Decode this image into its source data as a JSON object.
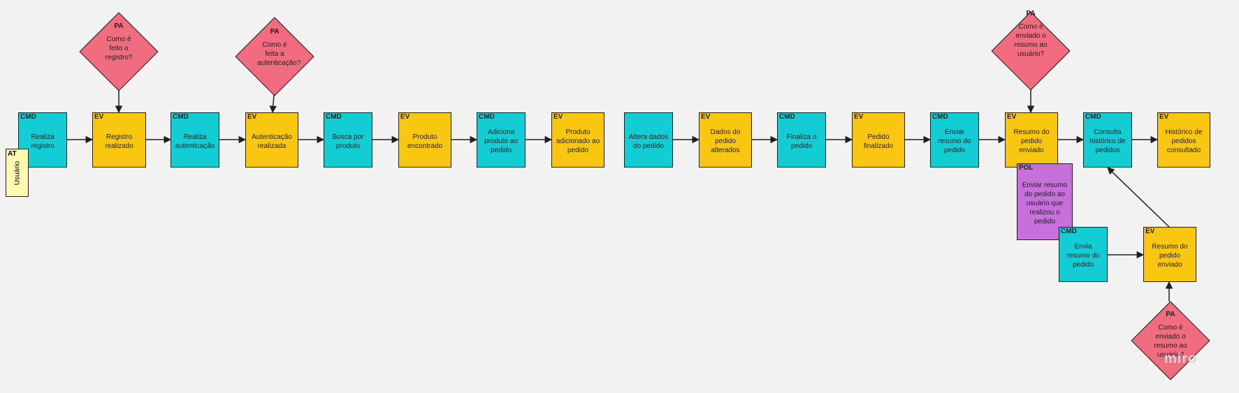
{
  "board": {
    "watermark": "miro",
    "actor": {
      "tag": "AT",
      "label": "Usuário"
    },
    "notes": [
      {
        "id": "n1",
        "type": "cmd",
        "tag": "CMD",
        "text": "Realiza registro"
      },
      {
        "id": "n2",
        "type": "ev",
        "tag": "EV",
        "text": "Registro realizado"
      },
      {
        "id": "n3",
        "type": "cmd",
        "tag": "CMD",
        "text": "Realiza autenticação"
      },
      {
        "id": "n4",
        "type": "ev",
        "tag": "EV",
        "text": "Autenticação realizada"
      },
      {
        "id": "n5",
        "type": "cmd",
        "tag": "CMD",
        "text": "Busca por produto"
      },
      {
        "id": "n6",
        "type": "ev",
        "tag": "EV",
        "text": "Produto encontrado"
      },
      {
        "id": "n7",
        "type": "cmd",
        "tag": "CMD",
        "text": "Adiciona produto ao pedido"
      },
      {
        "id": "n8",
        "type": "ev",
        "tag": "EV",
        "text": "Produto adicionado ao pedido"
      },
      {
        "id": "n9",
        "type": "cmd",
        "tag": "",
        "text": "Altera dados do pedido"
      },
      {
        "id": "n10",
        "type": "ev",
        "tag": "EV",
        "text": "Dados do pedido alterados"
      },
      {
        "id": "n11",
        "type": "cmd",
        "tag": "CMD",
        "text": "Finaliza o pedido"
      },
      {
        "id": "n12",
        "type": "ev",
        "tag": "EV",
        "text": "Pedido finalizado"
      },
      {
        "id": "n13",
        "type": "cmd",
        "tag": "CMD",
        "text": "Enviar resumo do pedido"
      },
      {
        "id": "n14",
        "type": "ev",
        "tag": "EV",
        "text": "Resumo do pedido enviado"
      },
      {
        "id": "n15",
        "type": "cmd",
        "tag": "CMD",
        "text": "Consulta histórico de pedidos"
      },
      {
        "id": "n16",
        "type": "ev",
        "tag": "EV",
        "text": "Histórico de pedidos consultado"
      },
      {
        "id": "n17",
        "type": "pol",
        "tag": "POL",
        "text": "Enviar resumo do pedido ao usuário que realizou o pedido"
      },
      {
        "id": "n18",
        "type": "cmd",
        "tag": "CMD",
        "text": "Envia resumo do pedido"
      },
      {
        "id": "n19",
        "type": "ev",
        "tag": "EV",
        "text": "Resumo do pedido enviado"
      }
    ],
    "questions": [
      {
        "id": "q1",
        "tag": "PA",
        "text": "Como é feito o registro?"
      },
      {
        "id": "q2",
        "tag": "PA",
        "text": "Como é feita a autenticação?"
      },
      {
        "id": "q3",
        "tag": "PA",
        "text": "Como é enviado o resumo ao usuário?"
      },
      {
        "id": "q4",
        "tag": "PA",
        "text": "Como é enviado o resumo ao usuário?"
      }
    ],
    "colors": {
      "command": "#12cdd4",
      "event": "#fac710",
      "policy": "#c770dc",
      "question": "#f16c7f",
      "actor": "#fff9b1",
      "background": "#f2f2f2"
    }
  }
}
